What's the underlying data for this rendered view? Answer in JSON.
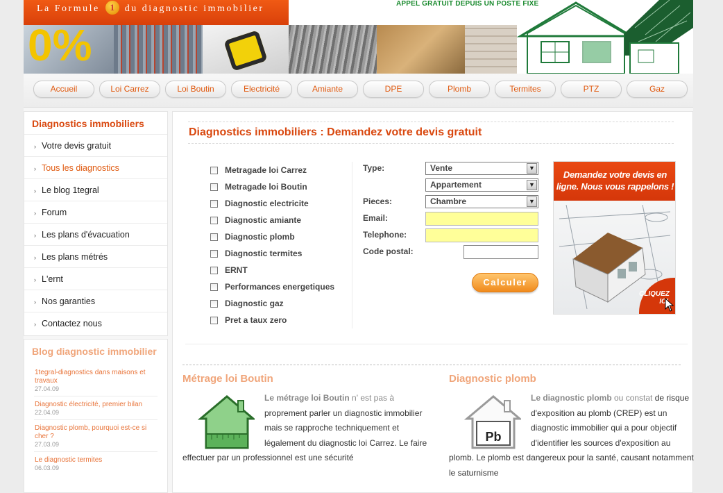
{
  "header": {
    "tagline_before": "La Formule",
    "tagline_badge": "1",
    "tagline_after": "du diagnostic immobilier",
    "banner_percent": "0%",
    "appel": "APPEL GRATUIT DEPUIS UN POSTE FIXE"
  },
  "nav": {
    "items": [
      {
        "label": "Accueil"
      },
      {
        "label": "Loi Carrez"
      },
      {
        "label": "Loi Boutin"
      },
      {
        "label": "Electricité"
      },
      {
        "label": "Amiante"
      },
      {
        "label": "DPE"
      },
      {
        "label": "Plomb"
      },
      {
        "label": "Termites"
      },
      {
        "label": "PTZ"
      },
      {
        "label": "Gaz"
      }
    ]
  },
  "sidebar": {
    "title": "Diagnostics immobiliers",
    "items": [
      {
        "label": "Votre devis gratuit"
      },
      {
        "label": "Tous les diagnostics"
      },
      {
        "label": "Le blog 1tegral"
      },
      {
        "label": "Forum"
      },
      {
        "label": "Les plans d'évacuation"
      },
      {
        "label": "Les plans métrés"
      },
      {
        "label": "L'ernt"
      },
      {
        "label": "Nos garanties"
      },
      {
        "label": "Contactez nous"
      }
    ],
    "active_index": 1,
    "blog": {
      "title": "Blog diagnostic immobilier",
      "posts": [
        {
          "title": "1tegral-diagnostics dans maisons et travaux",
          "date": "27.04.09"
        },
        {
          "title": "Diagnostic électricité, premier bilan",
          "date": "22.04.09"
        },
        {
          "title": "Diagnostic plomb, pourquoi est-ce si cher ?",
          "date": "27.03.09"
        },
        {
          "title": "Le diagnostic termites",
          "date": "06.03.09"
        }
      ]
    }
  },
  "main": {
    "title": "Diagnostics immobiliers : Demandez votre devis gratuit",
    "checkboxes": [
      {
        "label": "Metragade loi Carrez",
        "checked": false
      },
      {
        "label": "Metragade loi Boutin",
        "checked": false
      },
      {
        "label": "Diagnostic electricite",
        "checked": false
      },
      {
        "label": "Diagnostic amiante",
        "checked": false
      },
      {
        "label": "Diagnostic plomb",
        "checked": false
      },
      {
        "label": "Diagnostic termites",
        "checked": false
      },
      {
        "label": "ERNT",
        "checked": false
      },
      {
        "label": "Performances energetiques",
        "checked": false
      },
      {
        "label": "Diagnostic gaz",
        "checked": false
      },
      {
        "label": "Pret a taux zero",
        "checked": false
      }
    ],
    "form": {
      "type_label": "Type:",
      "type_value": "Vente",
      "bien_value": "Appartement",
      "pieces_label": "Pieces:",
      "pieces_value": "Chambre",
      "email_label": "Email:",
      "email_value": "",
      "telephone_label": "Telephone:",
      "telephone_value": "",
      "cp_label": "Code postal:",
      "cp_value": "",
      "submit_label": "Calculer"
    },
    "ad": {
      "headline": "Demandez votre devis en ligne. Nous vous rappelons !",
      "cta": "CLIQUEZ ICI"
    },
    "articles": [
      {
        "title": "Métrage loi Boutin",
        "icon": "house-ruler-icon",
        "lead_bold": "Le métrage loi Boutin",
        "lead_rest": " n' est pas à",
        "body": "proprement parler un diagnostic immobilier mais se rapproche techniquement et légalement du diagnostic loi Carrez. Le faire effectuer par un professionnel est une sécurité"
      },
      {
        "title": "Diagnostic plomb",
        "icon": "house-pb-icon",
        "icon_text": "Pb",
        "lead_bold": "Le diagnostic plomb",
        "lead_rest": " ou constat",
        "body": "de risque d'exposition au plomb (CREP) est un diagnostic immobilier qui a pour objectif d'identifier les sources d'exposition au plomb. Le plomb est dangereux pour la santé, causant notamment le saturnisme"
      }
    ]
  }
}
